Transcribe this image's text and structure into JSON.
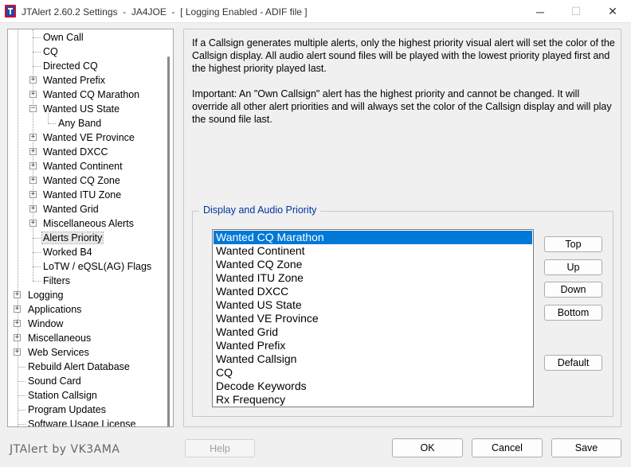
{
  "window": {
    "title": "JTAlert 2.60.2 Settings  -  JA4JOE  -  [ Logging Enabled - ADIF file ]",
    "minimize_glyph": "─",
    "maximize_glyph": "☐",
    "close_glyph": "✕"
  },
  "tree": {
    "items": [
      {
        "label": "Own Call"
      },
      {
        "label": "CQ"
      },
      {
        "label": "Directed CQ"
      },
      {
        "label": "Wanted Prefix",
        "expander": "+"
      },
      {
        "label": "Wanted CQ Marathon",
        "expander": "+"
      },
      {
        "label": "Wanted US State",
        "expander": "−"
      },
      {
        "label": "Any Band"
      },
      {
        "label": "Wanted VE Province",
        "expander": "+"
      },
      {
        "label": "Wanted DXCC",
        "expander": "+"
      },
      {
        "label": "Wanted Continent",
        "expander": "+"
      },
      {
        "label": "Wanted CQ Zone",
        "expander": "+"
      },
      {
        "label": "Wanted ITU Zone",
        "expander": "+"
      },
      {
        "label": "Wanted Grid",
        "expander": "+"
      },
      {
        "label": "Miscellaneous Alerts",
        "expander": "+"
      },
      {
        "label": "Alerts Priority",
        "selected": true
      },
      {
        "label": "Worked B4"
      },
      {
        "label": "LoTW / eQSL(AG) Flags"
      },
      {
        "label": "Filters"
      },
      {
        "label": "Logging",
        "expander": "+"
      },
      {
        "label": "Applications",
        "expander": "+"
      },
      {
        "label": "Window",
        "expander": "+"
      },
      {
        "label": "Miscellaneous",
        "expander": "+"
      },
      {
        "label": "Web Services",
        "expander": "+"
      },
      {
        "label": "Rebuild Alert Database"
      },
      {
        "label": "Sound Card"
      },
      {
        "label": "Station Callsign"
      },
      {
        "label": "Program Updates"
      },
      {
        "label": "Software Usage License"
      }
    ]
  },
  "info": {
    "paragraph1": "If a Callsign generates multiple alerts, only the highest priority visual alert will set the color of the Callsign display. All audio alert sound files will be played with the lowest priority played first and the highest priority played last.",
    "paragraph2": "Important: An \"Own Callsign\" alert has the highest priority and cannot be changed. It will override all other alert priorities and will always set the color of the Callsign display and will play the sound file last."
  },
  "priority": {
    "group_label": "Display and Audio Priority",
    "items": [
      {
        "label": "Wanted CQ Marathon",
        "selected": true
      },
      {
        "label": "Wanted Continent"
      },
      {
        "label": "Wanted CQ Zone"
      },
      {
        "label": "Wanted ITU Zone"
      },
      {
        "label": "Wanted DXCC"
      },
      {
        "label": "Wanted US State"
      },
      {
        "label": "Wanted VE Province"
      },
      {
        "label": "Wanted Grid"
      },
      {
        "label": "Wanted Prefix"
      },
      {
        "label": "Wanted Callsign"
      },
      {
        "label": "CQ"
      },
      {
        "label": "Decode Keywords"
      },
      {
        "label": "Rx Frequency"
      }
    ],
    "buttons": {
      "top": "Top",
      "up": "Up",
      "down": "Down",
      "bottom": "Bottom",
      "default": "Default"
    }
  },
  "footer": {
    "brand": "JTAlert by VK3AMA",
    "help": "Help",
    "ok": "OK",
    "cancel": "Cancel",
    "save": "Save"
  },
  "colors": {
    "selection": "#0078d7",
    "group_label": "#0033a0"
  }
}
